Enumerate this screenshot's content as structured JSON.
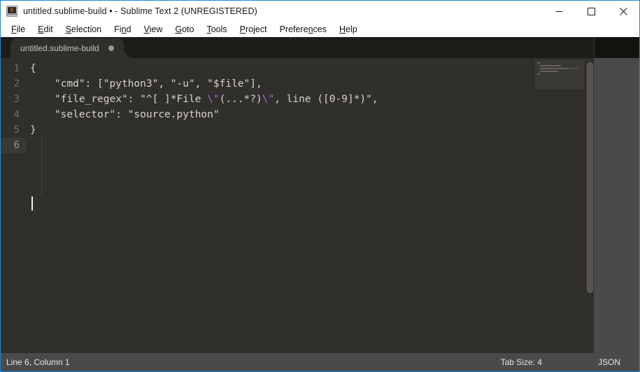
{
  "window": {
    "title": "untitled.sublime-build • - Sublime Text 2 (UNREGISTERED)",
    "app_icon": "sublime-text-icon",
    "accent_border": "#1a8ae0",
    "controls": {
      "minimize": "minimize-icon",
      "maximize": "maximize-icon",
      "close": "close-icon"
    }
  },
  "menubar": {
    "items": [
      {
        "pre": "",
        "mnemonic": "F",
        "post": "ile"
      },
      {
        "pre": "",
        "mnemonic": "E",
        "post": "dit"
      },
      {
        "pre": "",
        "mnemonic": "S",
        "post": "election"
      },
      {
        "pre": "Fi",
        "mnemonic": "n",
        "post": "d"
      },
      {
        "pre": "",
        "mnemonic": "V",
        "post": "iew"
      },
      {
        "pre": "",
        "mnemonic": "G",
        "post": "oto"
      },
      {
        "pre": "",
        "mnemonic": "T",
        "post": "ools"
      },
      {
        "pre": "",
        "mnemonic": "P",
        "post": "roject"
      },
      {
        "pre": "Prefere",
        "mnemonic": "n",
        "post": "ces"
      },
      {
        "pre": "",
        "mnemonic": "H",
        "post": "elp"
      }
    ]
  },
  "tabs": [
    {
      "label": "untitled.sublime-build",
      "modified": true,
      "active": true
    }
  ],
  "editor": {
    "background": "#302f2b",
    "foreground": "#d8d4ca",
    "escape_color": "#9b6bdc",
    "active_line": 6,
    "lines": [
      {
        "number": "1",
        "segments": [
          {
            "text": "{",
            "kind": "plain"
          }
        ]
      },
      {
        "number": "2",
        "segments": [
          {
            "text": "    \"cmd\": [\"python3\", \"-u\", \"$file\"],",
            "kind": "plain"
          }
        ]
      },
      {
        "number": "3",
        "segments": [
          {
            "text": "    \"file_regex\": \"^[ ]*File ",
            "kind": "plain"
          },
          {
            "text": "\\\"",
            "kind": "escape"
          },
          {
            "text": "(...*?)",
            "kind": "plain"
          },
          {
            "text": "\\\"",
            "kind": "escape"
          },
          {
            "text": ", line ([0-9]*)\",",
            "kind": "plain"
          }
        ]
      },
      {
        "number": "4",
        "segments": [
          {
            "text": "    \"selector\": \"source.python\"",
            "kind": "plain"
          }
        ]
      },
      {
        "number": "5",
        "segments": [
          {
            "text": "}",
            "kind": "plain"
          }
        ]
      },
      {
        "number": "6",
        "segments": [
          {
            "text": "",
            "kind": "plain"
          }
        ]
      }
    ]
  },
  "minimap": {
    "name": "minimap",
    "viewport_visible": true
  },
  "scrollbar": {
    "name": "vertical-scrollbar"
  },
  "statusbar": {
    "caret": "Line 6, Column 1",
    "tab_size": "Tab Size: 4",
    "syntax": "JSON"
  }
}
